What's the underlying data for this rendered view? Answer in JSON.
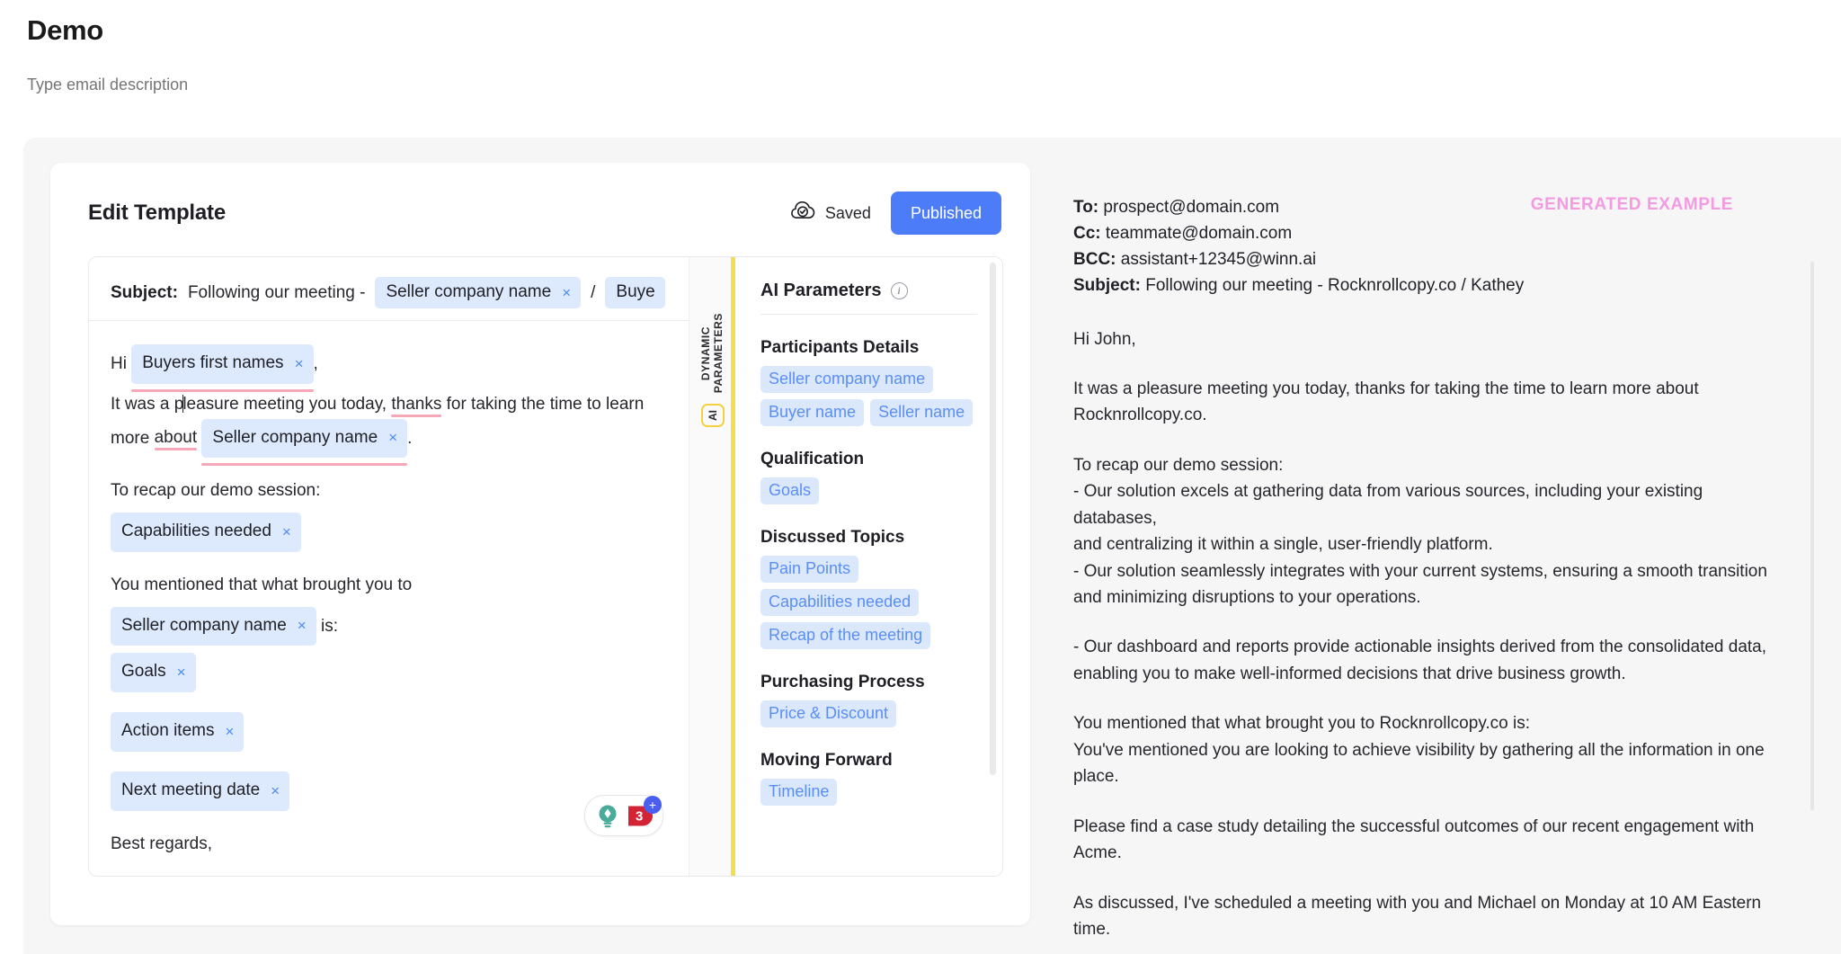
{
  "page": {
    "title": "Demo",
    "description_placeholder": "Type email description",
    "description_value": ""
  },
  "editor": {
    "card_title": "Edit Template",
    "saved_label": "Saved",
    "saved_icon": "cloud-check-icon",
    "publish_label": "Published"
  },
  "compose": {
    "subject_label": "Subject:",
    "subject_text_before": "Following our meeting -",
    "subject_chip_1": "Seller company name",
    "subject_separator": "/",
    "subject_chip_2_clipped": "Buye",
    "greeting_prefix": "Hi",
    "greeting_chip": "Buyers first names",
    "greeting_suffix": ",",
    "para1_a": "It was a p",
    "para1_b": "leasure meeting you today,",
    "para1_misspelled_1": "thanks",
    "para1_c": "for taking the time to",
    "para1_d": "learn more",
    "para1_misspelled_2": "about",
    "para1_chip": "Seller company name",
    "para1_end": ".",
    "para2_text": "To recap our demo session:",
    "para2_chip": "Capabilities needed",
    "para3_text": "You mentioned that what brought you to",
    "para3_chip_1": "Seller company name",
    "para3_mid": "is:",
    "para3_chip_2": "Goals",
    "para4_chip": "Action items",
    "para5_chip": "Next meeting date",
    "closing": "Best regards,",
    "chip_remove_glyph": "×",
    "tools": {
      "bulb_icon": "lightbulb-idea-icon",
      "badge_icon": "red-badge-3-icon",
      "badge_count": "3",
      "plus_glyph": "+"
    }
  },
  "dynamic_tab": {
    "label": "DYNAMIC\nPARAMETERS",
    "label_line1": "DYNAMIC",
    "label_line2": "PARAMETERS",
    "ai_badge": "AI",
    "accent_color": "#f7dc4d"
  },
  "ai_parameters": {
    "title": "AI Parameters",
    "info_icon": "info-circle-icon",
    "groups": [
      {
        "title": "Participants Details",
        "chips": [
          "Seller company name",
          "Buyer name",
          "Seller name"
        ]
      },
      {
        "title": "Qualification",
        "chips": [
          "Goals"
        ]
      },
      {
        "title": "Discussed Topics",
        "chips": [
          "Pain Points",
          "Capabilities needed",
          "Recap of the meeting"
        ]
      },
      {
        "title": "Purchasing Process",
        "chips": [
          "Price & Discount"
        ]
      },
      {
        "title": "Moving Forward",
        "chips": [
          "Timeline"
        ]
      }
    ]
  },
  "preview": {
    "generated_label": "GENERATED EXAMPLE",
    "meta": {
      "to_key": "To:",
      "to_value": "prospect@domain.com",
      "cc_key": "Cc:",
      "cc_value": "teammate@domain.com",
      "bcc_key": "BCC:",
      "bcc_value": "assistant+12345@winn.ai",
      "subject_key": "Subject:",
      "subject_value": "Following our meeting - Rocknrollcopy.co / Kathey"
    },
    "body": {
      "p1": "Hi John,",
      "p2": "It was a pleasure meeting you today, thanks for taking the time to learn more about Rocknrollcopy.co.",
      "p3": "To recap our demo session:\n- Our solution excels at gathering data from various sources, including your existing databases,\nand centralizing it within a single, user-friendly platform.\n- Our solution seamlessly integrates with your current systems, ensuring a smooth transition and minimizing disruptions to your operations.",
      "p4": "- Our dashboard and reports provide actionable insights derived from the consolidated data, enabling you to make well-informed decisions that drive business growth.",
      "p5": "You mentioned that what brought you to Rocknrollcopy.co is:\nYou've mentioned you are looking to achieve visibility by gathering all the information in one place.",
      "p6": "Please find a case study detailing the successful outcomes of our recent engagement with Acme.",
      "p7": "As discussed, I've scheduled a meeting with you and Michael on Monday at 10 AM Eastern time."
    }
  },
  "colors": {
    "accent_blue": "#4d7cf9",
    "chip_bg": "#dde9fc",
    "chip_text_blue": "#5b8ef5",
    "yellow_accent": "#f7dc4d",
    "pink_label": "#f49ae0",
    "spellcheck_underline": "#f4a8b8"
  }
}
